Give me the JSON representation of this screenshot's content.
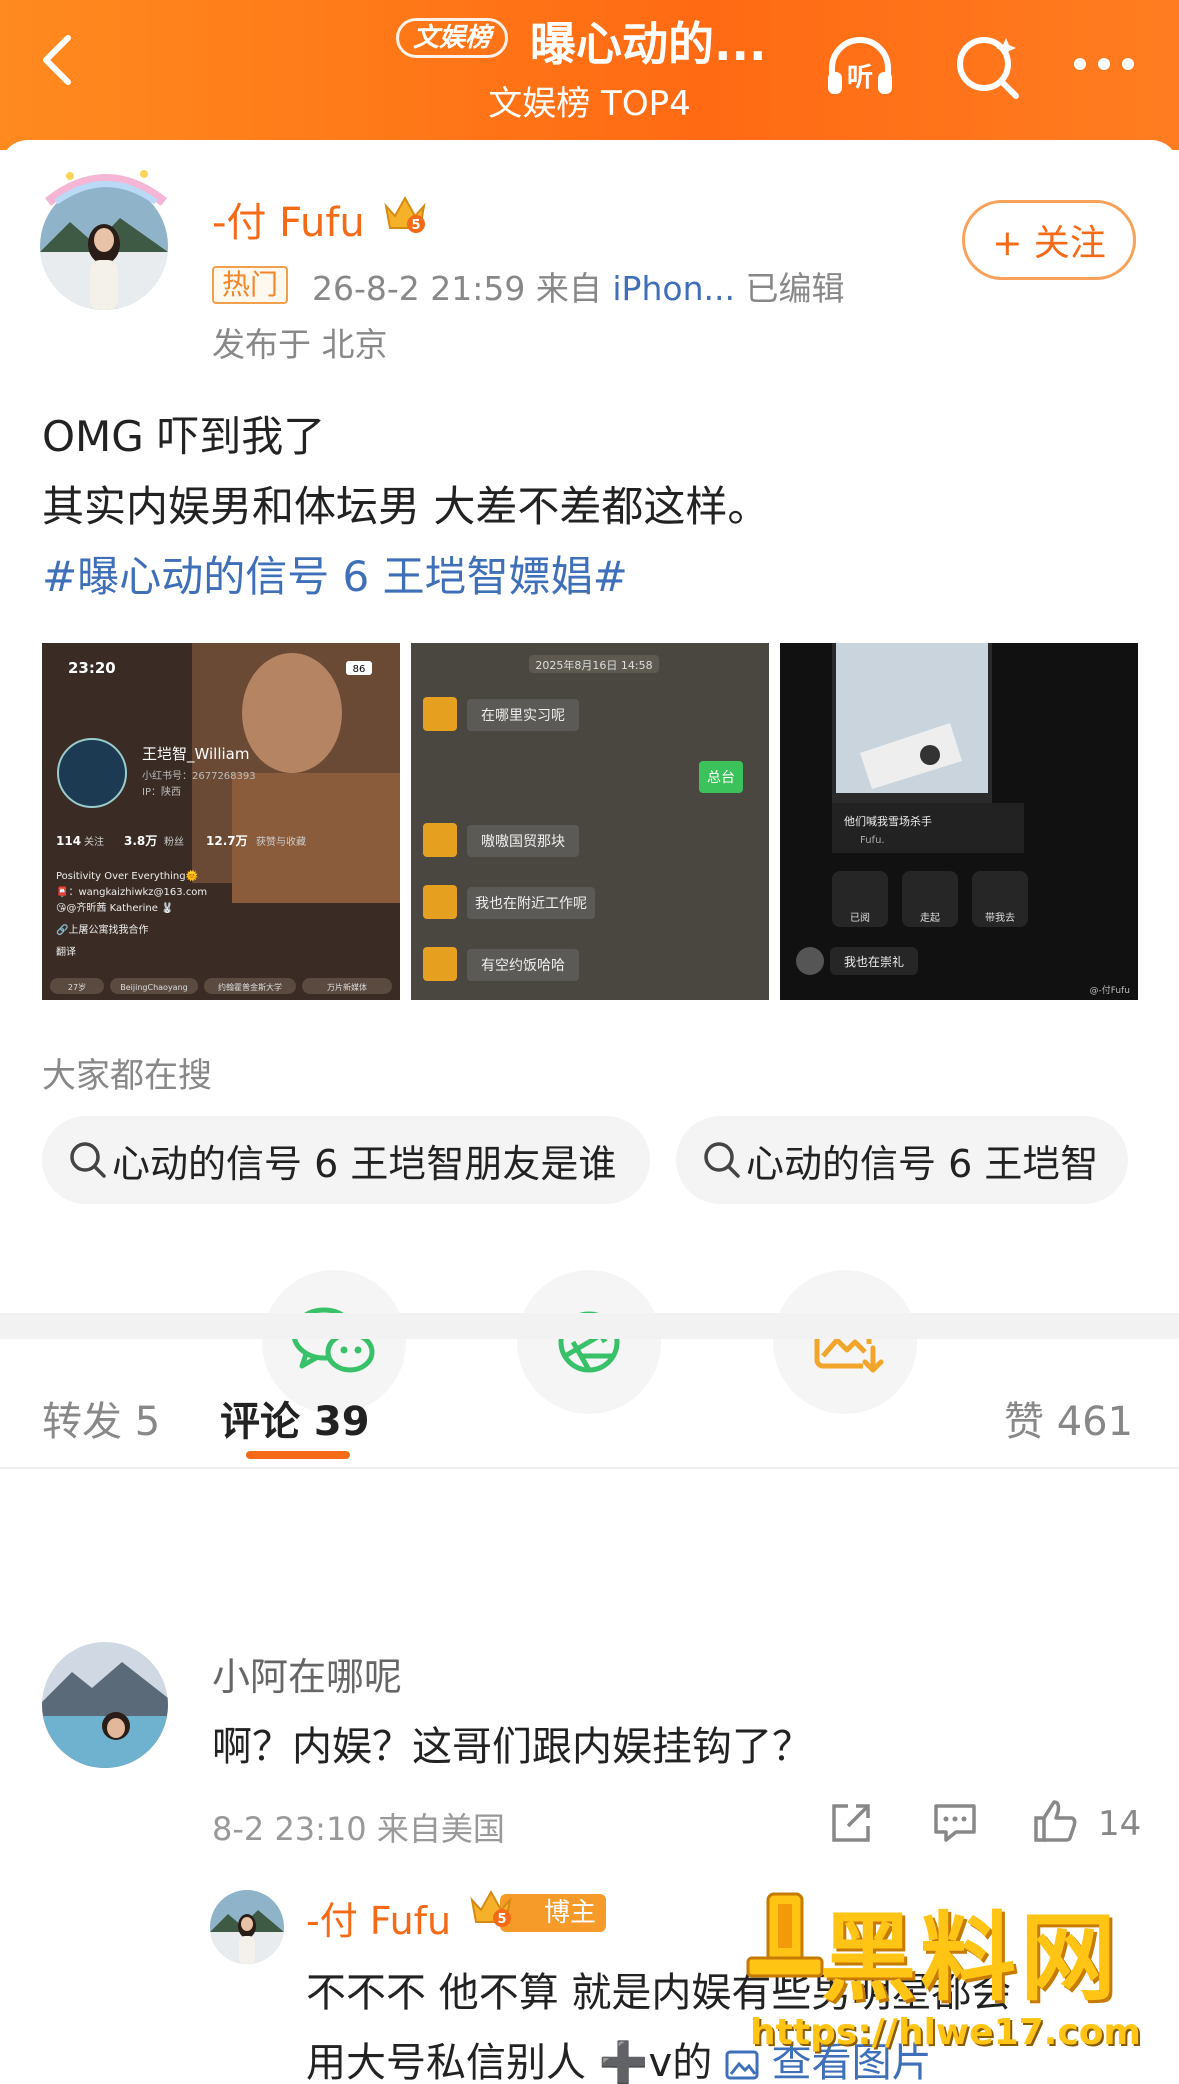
{
  "header": {
    "badge": "文娱榜",
    "title": "曝心动的...",
    "subtitle": "文娱榜 TOP4",
    "listen_label": "听"
  },
  "post": {
    "author": "-付 Fufu",
    "crown_level": "5",
    "hot_tag": "热门",
    "time": "26-8-2 21:59",
    "from_prefix": "来自",
    "source": "iPhon...",
    "edited": "已编辑",
    "location": "发布于 北京",
    "follow_label": "+ 关注",
    "lines": [
      "OMG 吓到我了",
      "其实内娱男和体坛男 大差不差都这样。"
    ],
    "hashtag": "#曝心动的信号 6 王垲智嫖娼#"
  },
  "images": {
    "profile": {
      "time": "23:20",
      "battery": "86",
      "name": "王垲智_William",
      "id": "小红书号：2677268393",
      "ip": "IP：陕西",
      "follow_num": "114",
      "follow_lbl": "关注",
      "fans_num": "3.8万",
      "fans_lbl": "粉丝",
      "likes_num": "12.7万",
      "likes_lbl": "获赞与收藏",
      "bio1": "Positivity Over Everything🌞",
      "bio2": "📮：wangkaizhiwkz@163.com",
      "bio3": "😘@齐昕茜 Katherine 🐰",
      "bio4": "🔗上屠公寓找我合作",
      "bio5": "翻译",
      "tags": [
        "27岁",
        "BeijingChaoyang",
        "约翰霍普金斯大学",
        "万片新媒体"
      ]
    },
    "chat": {
      "date": "2025年8月16日 14:58",
      "m1": "在哪里实习呢",
      "m2": "总台",
      "m3": "嗷嗷国贸那块",
      "m4": "我也在附近工作呢",
      "m5": "有空约饭哈哈"
    },
    "dm": {
      "caption": "他们喊我雪场杀手",
      "author": "Fufu.",
      "s1": "已阅",
      "s2": "走起",
      "s3": "带我去",
      "msg": "我也在崇礼",
      "wm": "@-付Fufu"
    }
  },
  "search": {
    "label": "大家都在搜",
    "chips": [
      "心动的信号 6 王垲智朋友是谁",
      "心动的信号 6 王垲智"
    ]
  },
  "tabs": {
    "repost": "转发 5",
    "comments": "评论 39",
    "likes": "赞 461"
  },
  "comment": {
    "name": "小阿在哪呢",
    "text": "啊？内娱？这哥们跟内娱挂钩了？",
    "meta": "8-2 23:10  来自美国",
    "likes": "14"
  },
  "reply": {
    "name": "-付 Fufu",
    "badge": "博主",
    "line1": "不不不 他不算 就是内娱有些男明星都会",
    "line2_prefix": "用大号私信别人 ➕v的",
    "line2_link": "查看图片"
  },
  "watermark": {
    "text": "黑料网",
    "url": "https://hlwe17.com"
  },
  "colors": {
    "accent": "#f46a16",
    "link": "#3e6fb8",
    "wechat": "#39c16a",
    "moments": "#39c16a",
    "save": "#f2a52b"
  }
}
